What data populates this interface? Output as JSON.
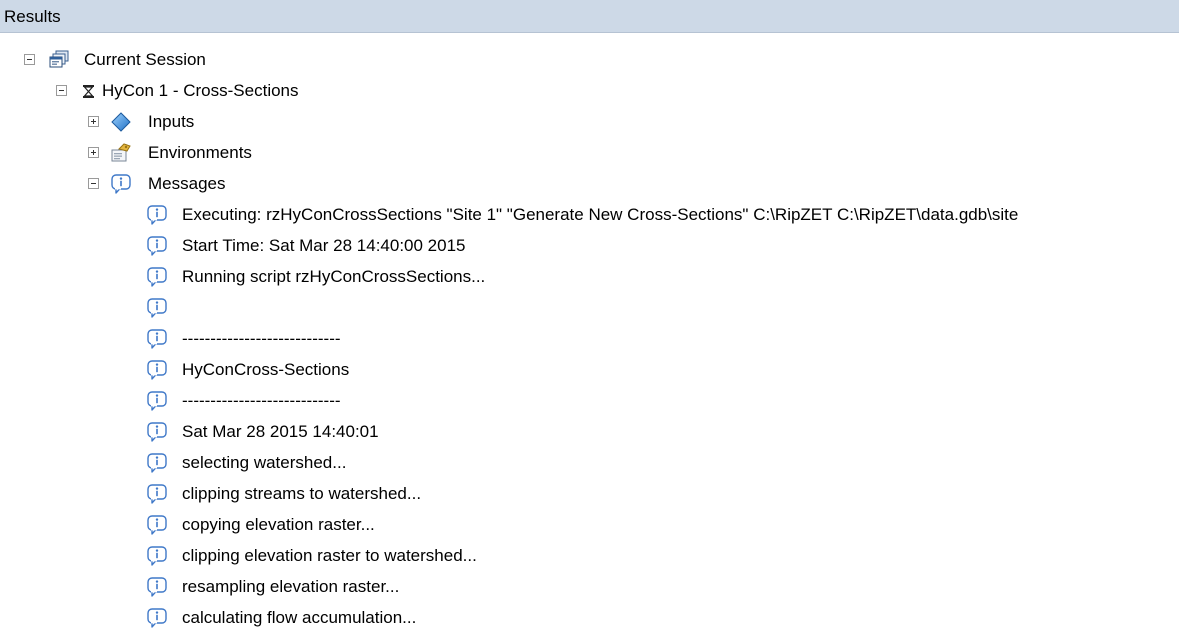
{
  "panel": {
    "title": "Results"
  },
  "tree": {
    "session": "Current Session",
    "tool": "HyCon 1 - Cross-Sections",
    "inputs": "Inputs",
    "environments": "Environments",
    "messages": "Messages"
  },
  "messages": [
    "Executing: rzHyConCrossSections \"Site 1\" \"Generate New Cross-Sections\" C:\\RipZET C:\\RipZET\\data.gdb\\site",
    "Start Time: Sat Mar 28 14:40:00 2015",
    "Running script rzHyConCrossSections...",
    "",
    "----------------------------",
    "HyConCross-Sections",
    "----------------------------",
    "Sat Mar 28 2015 14:40:01",
    "selecting watershed...",
    "clipping streams to watershed...",
    "copying elevation raster...",
    "clipping elevation raster to watershed...",
    "resampling elevation raster...",
    "calculating flow accumulation..."
  ]
}
